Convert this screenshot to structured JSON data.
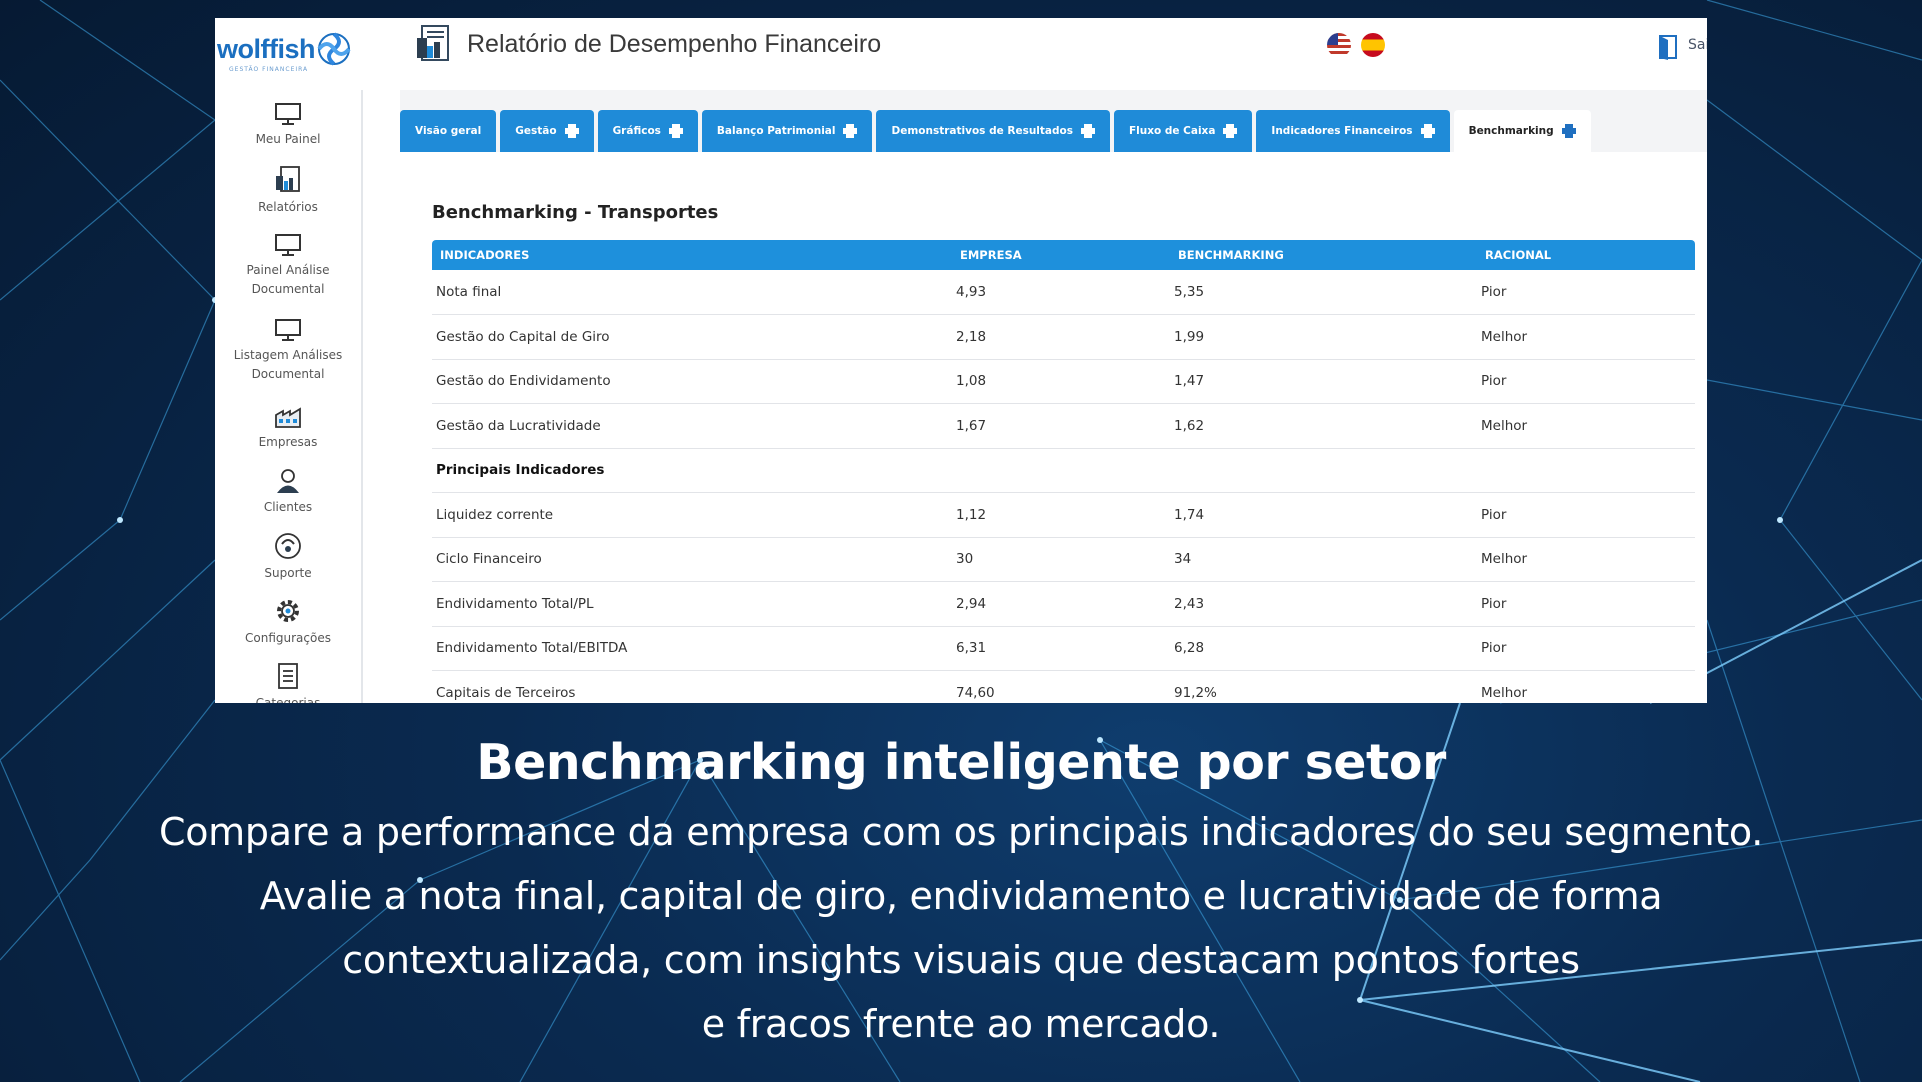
{
  "header": {
    "logo_text": "wolffish",
    "logo_sub": "GESTÃO FINANCEIRA",
    "title": "Relatório de Desempenho Financeiro",
    "exit_label": "Sai"
  },
  "sidebar": {
    "items": [
      {
        "label": "Meu Painel",
        "icon": "monitor-icon"
      },
      {
        "label": "Relatórios",
        "icon": "reports-icon"
      },
      {
        "label": "Painel Análise Documental",
        "icon": "monitor-icon"
      },
      {
        "label": "Listagem Análises Documental",
        "icon": "monitor-icon"
      },
      {
        "label": "Empresas",
        "icon": "factory-icon"
      },
      {
        "label": "Clientes",
        "icon": "user-icon"
      },
      {
        "label": "Suporte",
        "icon": "support-icon"
      },
      {
        "label": "Configurações",
        "icon": "gear-icon"
      },
      {
        "label": "Categorias",
        "icon": "document-icon"
      }
    ]
  },
  "tabs": [
    {
      "label": "Visão geral",
      "print": false
    },
    {
      "label": "Gestão",
      "print": true
    },
    {
      "label": "Gráficos",
      "print": true
    },
    {
      "label": "Balanço Patrimonial",
      "print": true
    },
    {
      "label": "Demonstrativos de Resultados",
      "print": true
    },
    {
      "label": "Fluxo de Caixa",
      "print": true
    },
    {
      "label": "Indicadores Financeiros",
      "print": true
    },
    {
      "label": "Benchmarking",
      "print": true,
      "active": true
    }
  ],
  "panel": {
    "title": "Benchmarking - Transportes",
    "columns": [
      "INDICADORES",
      "EMPRESA",
      "BENCHMARKING",
      "RACIONAL"
    ],
    "rows": [
      {
        "cells": [
          "Nota final",
          "4,93",
          "5,35",
          "Pior"
        ]
      },
      {
        "cells": [
          "Gestão do Capital de Giro",
          "2,18",
          "1,99",
          "Melhor"
        ]
      },
      {
        "cells": [
          "Gestão do Endividamento",
          "1,08",
          "1,47",
          "Pior"
        ]
      },
      {
        "cells": [
          "Gestão da Lucratividade",
          "1,67",
          "1,62",
          "Melhor"
        ]
      },
      {
        "cells": [
          "Principais Indicadores",
          "",
          "",
          ""
        ],
        "section": true
      },
      {
        "cells": [
          "Liquidez corrente",
          "1,12",
          "1,74",
          "Pior"
        ]
      },
      {
        "cells": [
          "Ciclo Financeiro",
          "30",
          "34",
          "Melhor"
        ]
      },
      {
        "cells": [
          "Endividamento Total/PL",
          "2,94",
          "2,43",
          "Pior"
        ]
      },
      {
        "cells": [
          "Endividamento Total/EBITDA",
          "6,31",
          "6,28",
          "Pior"
        ]
      },
      {
        "cells": [
          "Capitais de Terceiros",
          "74,60",
          "91,2%",
          "Melhor"
        ]
      }
    ]
  },
  "caption": {
    "title": "Benchmarking inteligente por setor",
    "lines": [
      "Compare a performance da empresa com os principais indicadores do seu segmento.",
      "Avalie a nota final, capital de giro, endividamento e lucratividade de forma",
      "contextualizada, com insights visuais que destacam pontos fortes",
      "e fracos frente ao mercado."
    ]
  },
  "colors": {
    "tab_blue": "#1f8bd8",
    "header_blue": "#1e90dc",
    "background_navy": "#0a2a50"
  }
}
